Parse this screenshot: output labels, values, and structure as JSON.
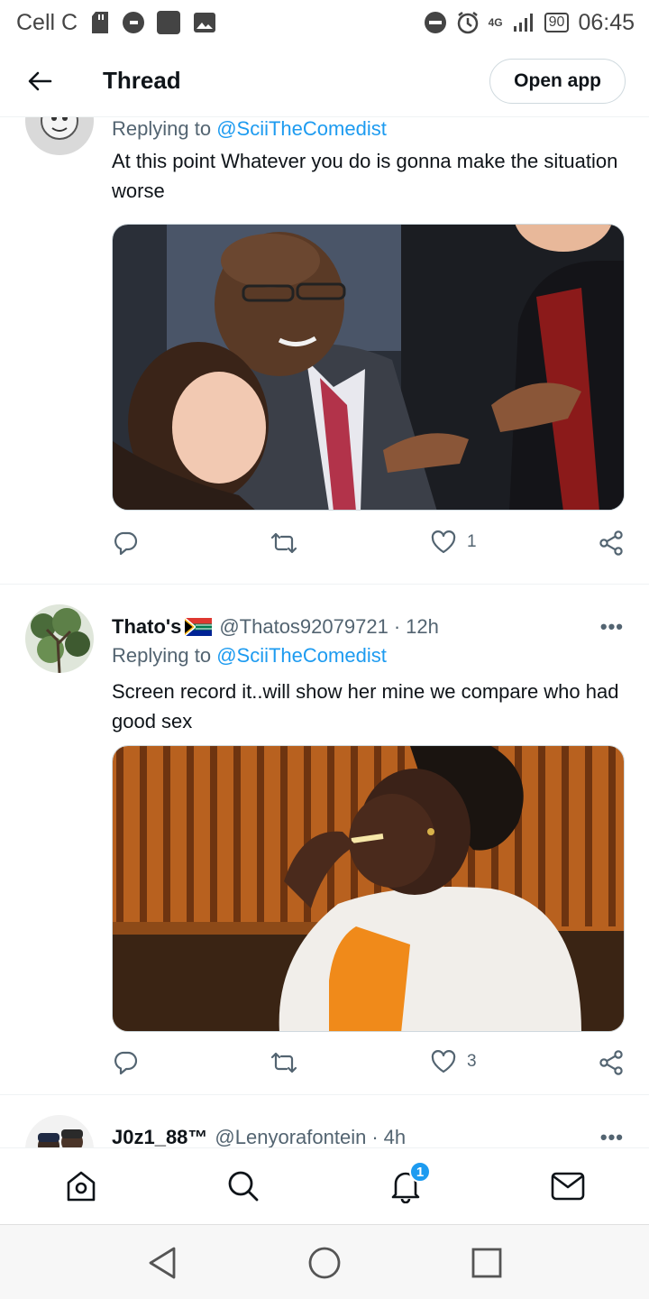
{
  "status_bar": {
    "carrier": "Cell C",
    "network": "4G",
    "battery": "90",
    "time": "06:45"
  },
  "header": {
    "title": "Thread",
    "open_app_label": "Open app"
  },
  "tweets": [
    {
      "name": "",
      "handle": "",
      "time": "",
      "reply_prefix": "Replying to",
      "reply_to": "@SciiTheComedist",
      "text": "At this point Whatever you do is gonna make the situation worse",
      "likes": "1"
    },
    {
      "name": "Thato's",
      "handle": "@Thatos92079721",
      "dot": "·",
      "time": "12h",
      "more": "•••",
      "reply_prefix": "Replying to",
      "reply_to": "@SciiTheComedist",
      "text": "Screen record it..will show her mine we compare who had good sex",
      "likes": "3"
    },
    {
      "name": "J0z1_88™",
      "handle": "@Lenyorafontein",
      "dot": "·",
      "time": "4h",
      "more": "•••"
    }
  ],
  "bottom_nav": {
    "notification_count": "1",
    "items": [
      "home-icon",
      "search-icon",
      "bell-icon",
      "mail-icon"
    ]
  },
  "colors": {
    "accent": "#1d9bf0",
    "secondary_text": "#536471",
    "primary_text": "#0f1419"
  }
}
